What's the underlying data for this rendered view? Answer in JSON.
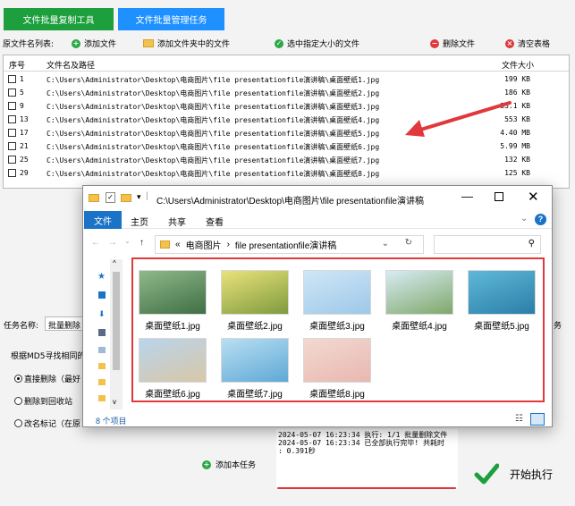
{
  "tabs": {
    "copy_tool": "文件批量复制工具",
    "manage_task": "文件批量管理任务"
  },
  "toolbar": {
    "list_label": "原文件名列表:",
    "add_file": "添加文件",
    "add_folder_files": "添加文件夹中的文件",
    "select_by_size": "选中指定大小的文件",
    "delete_file": "删除文件",
    "clear_table": "清空表格"
  },
  "table": {
    "col_index": "序号",
    "col_name": "文件名及路径",
    "col_size": "文件大小",
    "rows": [
      {
        "num": "1",
        "path": "C:\\Users\\Administrator\\Desktop\\电商图片\\file presentationfile演讲稿\\桌面壁纸1.jpg",
        "size": "199 KB"
      },
      {
        "num": "5",
        "path": "C:\\Users\\Administrator\\Desktop\\电商图片\\file presentationfile演讲稿\\桌面壁纸2.jpg",
        "size": "186 KB"
      },
      {
        "num": "9",
        "path": "C:\\Users\\Administrator\\Desktop\\电商图片\\file presentationfile演讲稿\\桌面壁纸3.jpg",
        "size": "33.1 KB"
      },
      {
        "num": "13",
        "path": "C:\\Users\\Administrator\\Desktop\\电商图片\\file presentationfile演讲稿\\桌面壁纸4.jpg",
        "size": "553 KB"
      },
      {
        "num": "17",
        "path": "C:\\Users\\Administrator\\Desktop\\电商图片\\file presentationfile演讲稿\\桌面壁纸5.jpg",
        "size": "4.40 MB"
      },
      {
        "num": "21",
        "path": "C:\\Users\\Administrator\\Desktop\\电商图片\\file presentationfile演讲稿\\桌面壁纸6.jpg",
        "size": "5.99 MB"
      },
      {
        "num": "25",
        "path": "C:\\Users\\Administrator\\Desktop\\电商图片\\file presentationfile演讲稿\\桌面壁纸7.jpg",
        "size": "132 KB"
      },
      {
        "num": "29",
        "path": "C:\\Users\\Administrator\\Desktop\\电商图片\\file presentationfile演讲稿\\桌面壁纸8.jpg",
        "size": "125 KB"
      }
    ]
  },
  "task": {
    "name_label": "任务名称:",
    "name_value": "批量删除",
    "right_label": "务",
    "hint": "根据MD5寻找相同的",
    "option_direct": "直接删除（最好",
    "option_recycle": "删除到回收站",
    "option_rename": "改名标记（在原",
    "add_task": "添加本任务"
  },
  "log": {
    "lines": [
      "2024-05-07 16:23:34 执行: 1/1 批量删除文件",
      "2024-05-07 16:23:34 已全部执行完毕! 共耗时",
      ": 0.391秒"
    ]
  },
  "start_button": "开始执行",
  "explorer": {
    "title": "C:\\Users\\Administrator\\Desktop\\电商图片\\file presentationfile演讲稿",
    "ribbon": {
      "file": "文件",
      "home": "主页",
      "share": "共享",
      "view": "查看"
    },
    "breadcrumb_prefix": "«",
    "breadcrumb_1": "电商图片",
    "breadcrumb_2": "file presentationfile演讲稿",
    "items": [
      {
        "name": "桌面壁纸1.jpg",
        "c1": "#8fb98a",
        "c2": "#3f6f45"
      },
      {
        "name": "桌面壁纸2.jpg",
        "c1": "#e9e27a",
        "c2": "#7f9b3e"
      },
      {
        "name": "桌面壁纸3.jpg",
        "c1": "#cfe6f7",
        "c2": "#9ec8e8"
      },
      {
        "name": "桌面壁纸4.jpg",
        "c1": "#d8ecf5",
        "c2": "#7fa86a"
      },
      {
        "name": "桌面壁纸5.jpg",
        "c1": "#5fb8d8",
        "c2": "#2a7fa8"
      },
      {
        "name": "桌面壁纸6.jpg",
        "c1": "#b9d4ec",
        "c2": "#d8c7a8"
      },
      {
        "name": "桌面壁纸7.jpg",
        "c1": "#b8dff2",
        "c2": "#5fa8d6"
      },
      {
        "name": "桌面壁纸8.jpg",
        "c1": "#f2d9d0",
        "c2": "#e8b8b0"
      }
    ],
    "status": "8 个项目"
  },
  "colors": {
    "accent_red": "#e0383b",
    "green_tab": "#1c9f3c",
    "blue_tab": "#1e90ff"
  }
}
